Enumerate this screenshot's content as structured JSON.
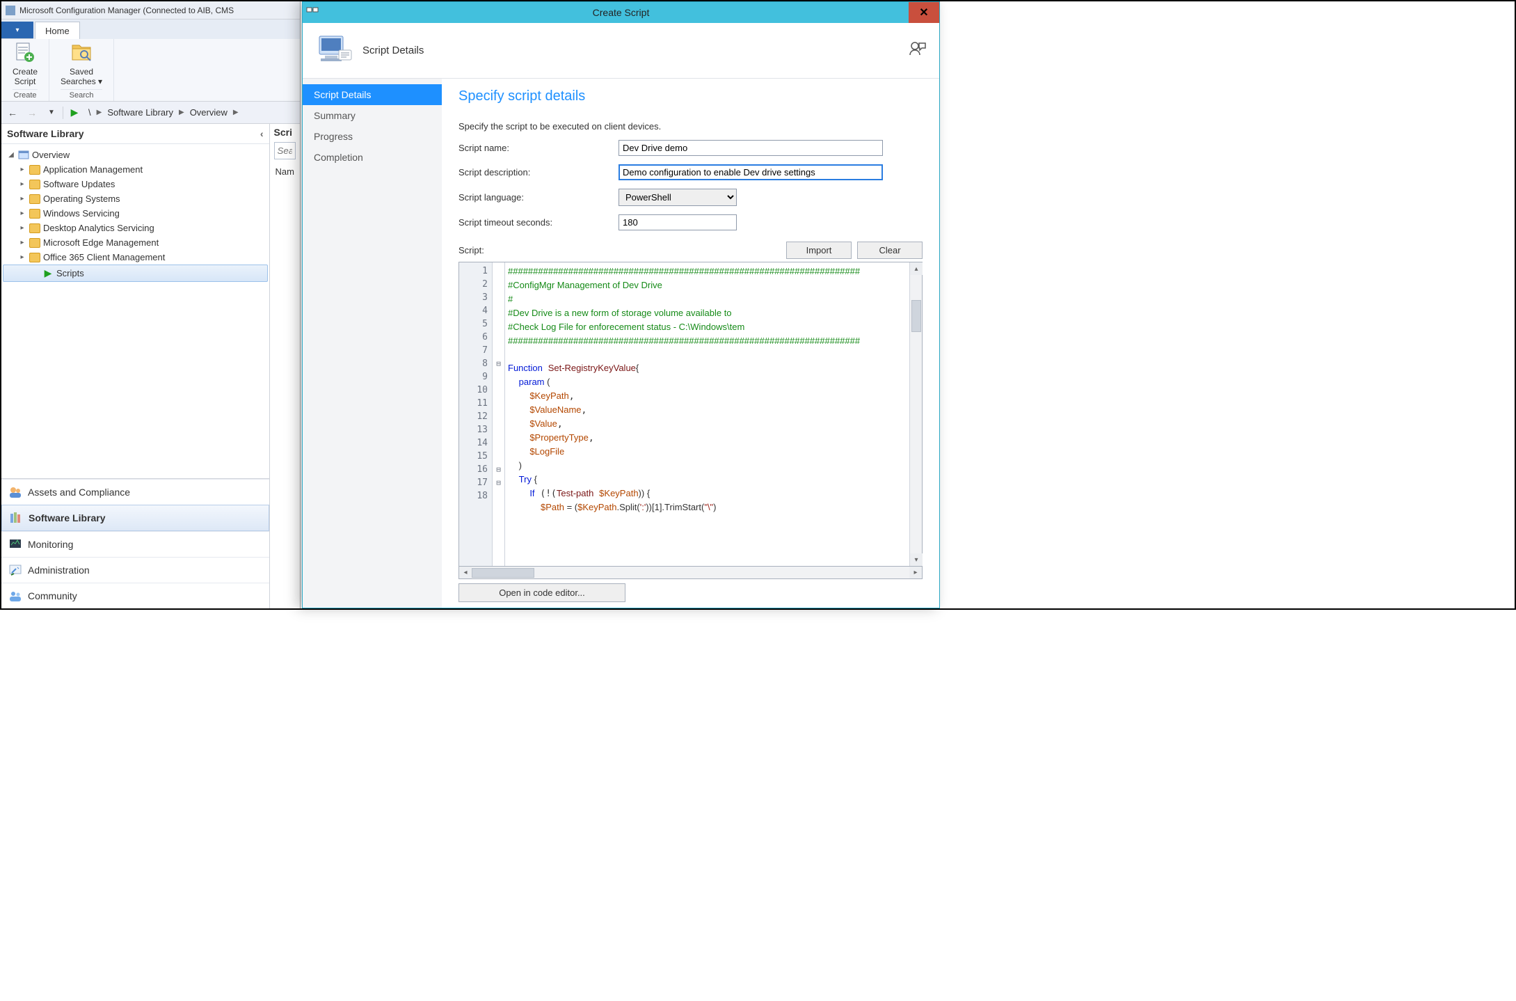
{
  "scm": {
    "windowTitle": "Microsoft Configuration Manager (Connected to AIB, CMS",
    "homeTab": "Home",
    "ribbon": {
      "createScript": "Create\nScript",
      "createGroup": "Create",
      "savedSearches": "Saved\nSearches ▾",
      "searchGroup": "Search"
    },
    "breadcrumb": {
      "root": "\\",
      "p1": "Software Library",
      "p2": "Overview"
    },
    "treeHeader": "Software Library",
    "tree": {
      "overview": "Overview",
      "items": [
        "Application Management",
        "Software Updates",
        "Operating Systems",
        "Windows Servicing",
        "Desktop Analytics Servicing",
        "Microsoft Edge Management",
        "Office 365 Client Management"
      ],
      "scripts": "Scripts"
    },
    "wunder": [
      "Assets and Compliance",
      "Software Library",
      "Monitoring",
      "Administration",
      "Community"
    ],
    "list": {
      "hdr": "Scri",
      "searchPh": "Sea",
      "nameCol": "Nam"
    }
  },
  "modal": {
    "title": "Create Script",
    "headerTitle": "Script Details",
    "steps": [
      "Script Details",
      "Summary",
      "Progress",
      "Completion"
    ],
    "h2": "Specify script details",
    "hint": "Specify the script to be executed on client devices.",
    "labels": {
      "name": "Script name:",
      "desc": "Script description:",
      "lang": "Script language:",
      "timeout": "Script timeout seconds:",
      "script": "Script:"
    },
    "vals": {
      "name": "Dev Drive demo",
      "desc": "Demo configuration to enable Dev drive settings",
      "lang": "PowerShell",
      "timeout": "180"
    },
    "btns": {
      "import": "Import",
      "clear": "Clear",
      "open": "Open in code editor..."
    },
    "code": {
      "l1": "######################################################################",
      "l2": "#ConfigMgr Management of Dev Drive",
      "l3": "#",
      "l4": "#Dev Drive is a new form of storage volume available to ",
      "l5": "#Check Log File for enforecement status - C:\\Windows\\tem",
      "l6": "######################################################################",
      "kw_fn": "Function",
      "fn": "Set-RegistryKeyValue",
      "br": "{",
      "kw_param": "param",
      "p_open": " (",
      "v1": "$KeyPath",
      "v2": "$ValueName",
      "v3": "$Value",
      "v4": "$PropertyType",
      "v5": "$LogFile",
      "p_close": ")",
      "kw_try": "Try",
      "try_open": " {",
      "kw_if": "If",
      "tp": "Test-path",
      "kp": "$KeyPath",
      "if_tail": ")) {",
      "l18a": "$Path",
      "l18b": " = (",
      "l18c": "$KeyPath",
      "l18d": ".Split(",
      "l18e": "':'",
      "l18f": "))[",
      "l18g": "1",
      "l18h": "].TrimStart(",
      "l18i": "\"\\\"",
      "l18j": ")"
    }
  }
}
